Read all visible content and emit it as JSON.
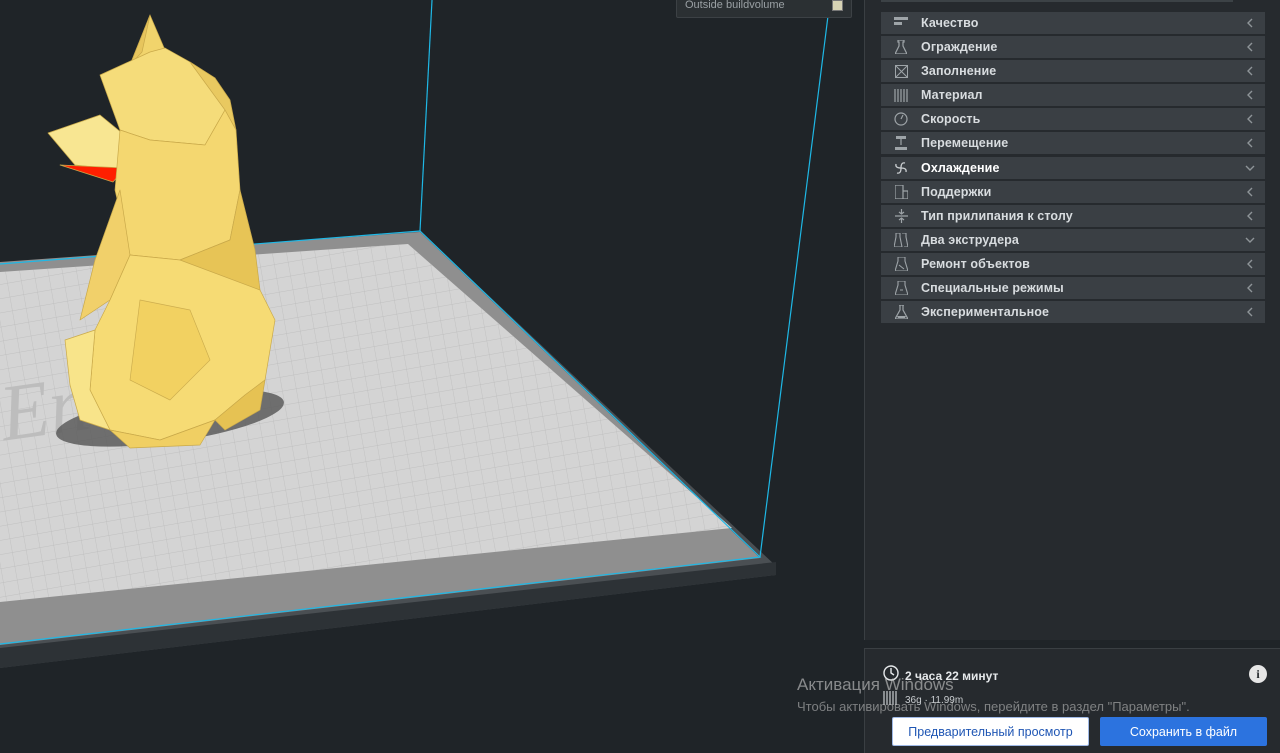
{
  "viewport": {
    "legend_text": "Outside buildvolume",
    "model_name": "low-poly dog",
    "colors": {
      "model": "#f5dc7a",
      "model_highlight": "#ff1f00",
      "build_volume": "#1fb8e6",
      "plate": "#c9c9c9"
    }
  },
  "settings": {
    "categories": [
      {
        "label": "Качество",
        "icon": "quality-icon",
        "state": "collapsed"
      },
      {
        "label": "Ограждение",
        "icon": "shell-icon",
        "state": "collapsed"
      },
      {
        "label": "Заполнение",
        "icon": "infill-icon",
        "state": "collapsed"
      },
      {
        "label": "Материал",
        "icon": "material-icon",
        "state": "collapsed"
      },
      {
        "label": "Скорость",
        "icon": "speed-icon",
        "state": "collapsed"
      },
      {
        "label": "Перемещение",
        "icon": "travel-icon",
        "state": "collapsed"
      },
      {
        "label": "Охлаждение",
        "icon": "fan-icon",
        "state": "expanded"
      },
      {
        "label": "Поддержки",
        "icon": "support-icon",
        "state": "collapsed"
      },
      {
        "label": "Тип прилипания к столу",
        "icon": "adhesion-icon",
        "state": "collapsed"
      },
      {
        "label": "Два экструдера",
        "icon": "dual-extruder-icon",
        "state": "expanded"
      },
      {
        "label": "Ремонт объектов",
        "icon": "mesh-fix-icon",
        "state": "collapsed"
      },
      {
        "label": "Специальные режимы",
        "icon": "special-modes-icon",
        "state": "collapsed"
      },
      {
        "label": "Экспериментальное",
        "icon": "experimental-icon",
        "state": "collapsed"
      }
    ]
  },
  "print_info": {
    "time": "2 часа 22 минут",
    "material": "36g · 11.99m"
  },
  "buttons": {
    "preview": "Предварительный просмотр",
    "save": "Сохранить в файл"
  },
  "watermark": {
    "title": "Активация Windows",
    "subtitle": "Чтобы активировать Windows, перейдите в раздел \"Параметры\"."
  },
  "colors": {
    "accent": "#2c73df",
    "panel_bg": "#262a2e",
    "category_bg": "#3a3f44"
  }
}
